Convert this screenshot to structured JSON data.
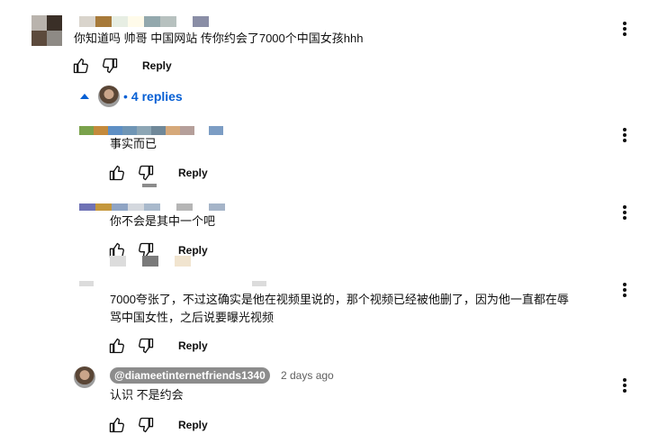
{
  "colors": {
    "accent": "#065fd4",
    "text": "#0f0f0f",
    "secondary": "#606060",
    "chip": "#8c8c8c"
  },
  "comment": {
    "text": "你知道吗 帅哥 中国网站 传你约会了7000个中国女孩hhh",
    "reply_label": "Reply",
    "icons": [
      "like-icon",
      "dislike-icon",
      "more-options-icon"
    ]
  },
  "replies_toggle": {
    "label": "4 replies",
    "icon": "caret-up-icon"
  },
  "replies": [
    {
      "text": "事实而已",
      "reply_label": "Reply"
    },
    {
      "text": "你不会是其中一个吧",
      "reply_label": "Reply"
    },
    {
      "text_line1": "7000夸张了，不过这确实是他在视频里说的，那个视频已经被他删了，因为他一直都在辱",
      "text_line2": "骂中国女性，之后说要曝光视频",
      "reply_label": "Reply"
    },
    {
      "handle": "@diameetinternetfriends1340",
      "timestamp": "2 days ago",
      "text": "认识 不是约会",
      "reply_label": "Reply"
    }
  ]
}
